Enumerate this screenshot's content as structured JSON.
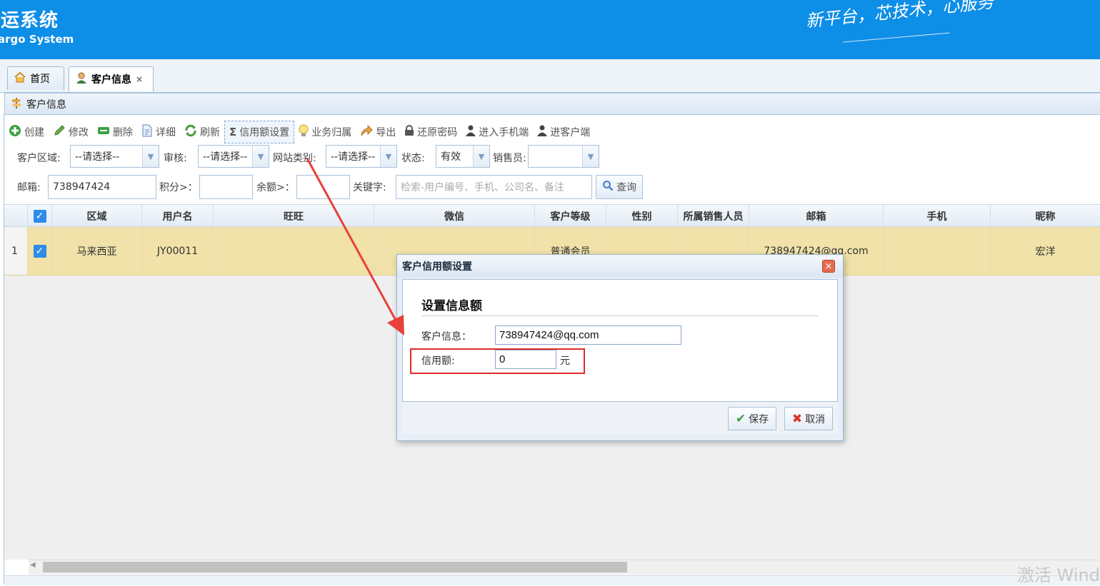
{
  "header": {
    "logo_main": "集运系统",
    "logo_sub": "Cargo System",
    "slogan": "新平台，芯技术，心服务"
  },
  "tabs": [
    {
      "label": "首页",
      "icon": "home-icon"
    },
    {
      "label": "客户信息",
      "icon": "user-icon",
      "close": "×"
    }
  ],
  "panel": {
    "title": "客户信息"
  },
  "toolbar": [
    {
      "label": "创建",
      "icon": "plus-circle-icon"
    },
    {
      "label": "修改",
      "icon": "pencil-icon"
    },
    {
      "label": "删除",
      "icon": "minus-icon"
    },
    {
      "label": "详细",
      "icon": "document-icon"
    },
    {
      "label": "刷新",
      "icon": "refresh-icon"
    },
    {
      "label": "信用额设置",
      "icon": "sigma-icon"
    },
    {
      "label": "业务归属",
      "icon": "lightbulb-icon"
    },
    {
      "label": "导出",
      "icon": "export-icon"
    },
    {
      "label": "还原密码",
      "icon": "lock-icon"
    },
    {
      "label": "进入手机端",
      "icon": "person-icon"
    },
    {
      "label": "进客户端",
      "icon": "person-icon"
    }
  ],
  "filters": {
    "region_label": "客户区域:",
    "region_value": "--请选择--",
    "audit_label": "审核:",
    "audit_value": "--请选择--",
    "site_label": "网站类别:",
    "site_value": "--请选择--",
    "status_label": "状态:",
    "status_value": "有效",
    "sales_label": "销售员:",
    "sales_value": "",
    "email_label": "邮箱:",
    "email_value": "738947424",
    "points_label": "积分>：",
    "balance_label": "余额>：",
    "keyword_label": "关键字:",
    "keyword_placeholder": "检索-用户编号、手机、公司名、备注",
    "query_label": "查询"
  },
  "grid": {
    "columns": [
      "区域",
      "用户名",
      "旺旺",
      "微信",
      "客户等级",
      "性别",
      "所属销售人员",
      "邮箱",
      "手机",
      "昵称"
    ],
    "rows": [
      {
        "index": "1",
        "region": "马来西亚",
        "username": "JY00011",
        "wangwang": "",
        "wechat": "",
        "level": "普通会员",
        "gender": "",
        "sales": "",
        "email": "738947424@qq.com",
        "phone": "",
        "nickname": "宏洋"
      }
    ]
  },
  "watermark": "激活 Windows",
  "dialog": {
    "title": "客户信用额设置",
    "close": "×",
    "heading": "设置信息额",
    "customer_label": "客户信息：",
    "customer_value": "738947424@qq.com",
    "credit_label": "信用额:",
    "credit_value": "0",
    "credit_unit": "元",
    "save_label": "保存",
    "cancel_label": "取消"
  },
  "colors": {
    "header_bg": "#0d8ee7",
    "row_selected": "#f0e2a8",
    "annotation_red": "#e02a2a"
  }
}
